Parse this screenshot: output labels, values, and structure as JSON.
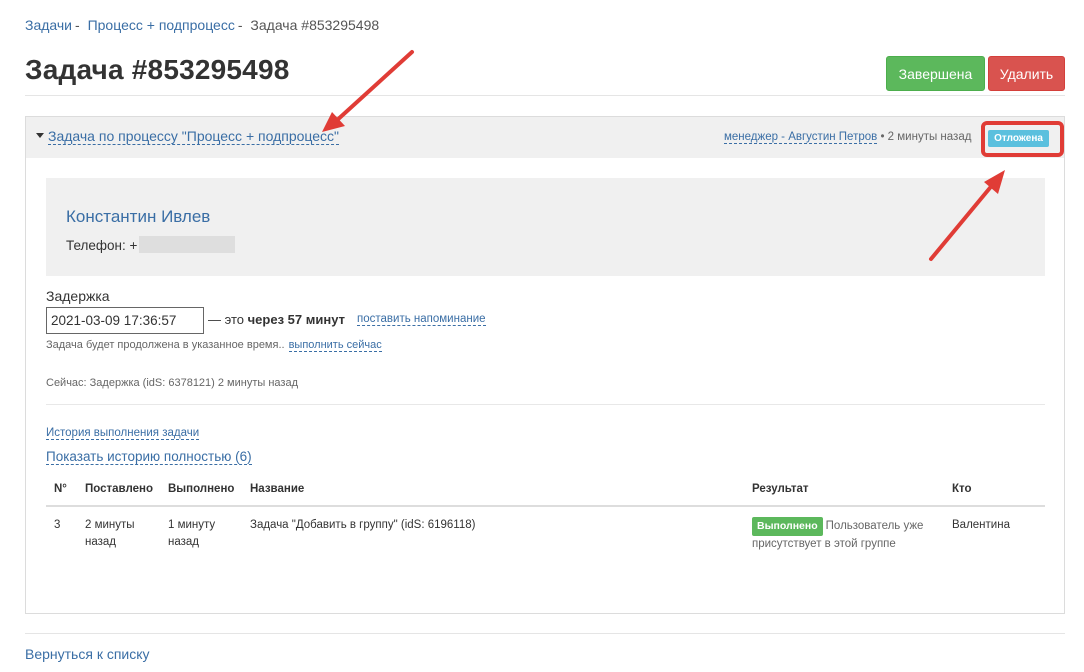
{
  "breadcrumb": {
    "items": [
      "Задачи",
      "Процесс + подпроцесс"
    ],
    "separator": "-",
    "current": "Задача #853295498"
  },
  "header": {
    "title": "Задача #853295498",
    "done_button": "Завершена",
    "delete_button": "Удалить"
  },
  "panel": {
    "title": "Задача по процессу \"Процесс + подпроцесс\"",
    "manager": "менеджер - Августин Петров",
    "time_ago": "• 2 минуты назад",
    "status": "Отложена"
  },
  "contact": {
    "name": "Константин Ивлев",
    "phone_label": "Телефон: +"
  },
  "delay": {
    "label": "Задержка",
    "value": "2021-03-09 17:36:57",
    "prefix": "— это",
    "relative_bold": "через",
    "relative_number": "57",
    "relative_unit": "минут",
    "reminder_link": "поставить напоминание",
    "note": "Задача будет продолжена в указанное время..",
    "run_now": "выполнить сейчас"
  },
  "now_line": "Сейчас: Задержка (idS: 6378121) 2 минуты назад",
  "history": {
    "link": "История выполнения задачи",
    "full_link": "Показать историю полностью (6)",
    "columns": [
      "N°",
      "Поставлено",
      "Выполнено",
      "Название",
      "Результат",
      "Кто"
    ],
    "rows": [
      {
        "num": "3",
        "placed_1": "2 минуты",
        "placed_2": "назад",
        "done_1": "1 минуту",
        "done_2": "назад",
        "name": "Задача \"Добавить в группу\" (idS: 6196118)",
        "result_badge": "Выполнено",
        "result_text_1": "Пользователь уже",
        "result_text_2": "присутствует в этой группе",
        "who": "Валентина"
      }
    ]
  },
  "footer": {
    "back_link": "Вернуться к списку"
  },
  "colors": {
    "accent_link": "#3a6ea5",
    "success": "#5cb85c",
    "danger": "#d9534f",
    "info": "#5bc0de",
    "annotation_red": "#e03c36"
  },
  "icons": [
    "caret-down-icon",
    "annotation-arrow"
  ]
}
